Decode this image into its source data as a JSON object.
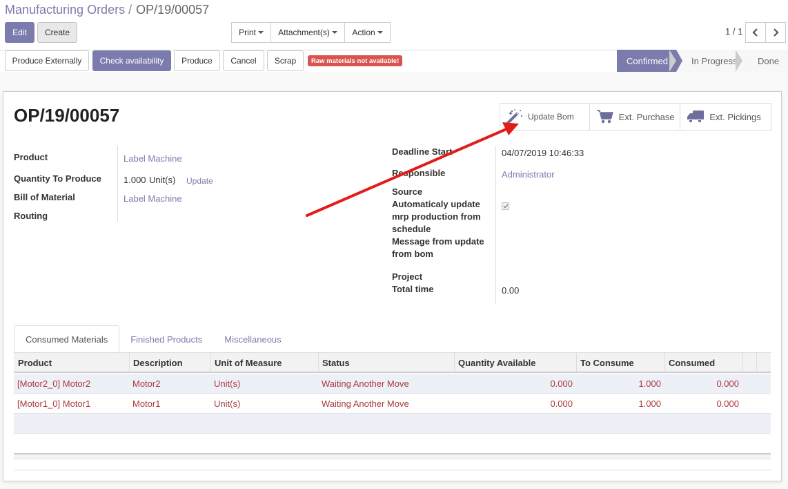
{
  "breadcrumb": {
    "parent": "Manufacturing Orders",
    "separator": "/",
    "current": "OP/19/00057"
  },
  "toolbar": {
    "edit": "Edit",
    "create": "Create",
    "print": "Print",
    "attachments": "Attachment(s)",
    "action": "Action"
  },
  "pager": {
    "value": "1 / 1",
    "prev_icon": "chevron-left-icon",
    "next_icon": "chevron-right-icon"
  },
  "header_buttons": {
    "produce_externally": "Produce Externally",
    "check_availability": "Check availability",
    "produce": "Produce",
    "cancel": "Cancel",
    "scrap": "Scrap",
    "warning_badge": "Raw materials not available!"
  },
  "statusbar": {
    "stages": [
      {
        "label": "Confirmed",
        "active": true
      },
      {
        "label": "In Progress",
        "active": false
      },
      {
        "label": "Done",
        "active": false
      }
    ]
  },
  "smart_buttons": [
    {
      "label": "Update Bom",
      "icon": "magic-wand-icon"
    },
    {
      "label": "Ext. Purchase",
      "icon": "shopping-cart-icon"
    },
    {
      "label": "Ext. Pickings",
      "icon": "truck-icon"
    }
  ],
  "record": {
    "title": "OP/19/00057",
    "left": {
      "product_label": "Product",
      "product_value": "Label Machine",
      "qty_label": "Quantity To Produce",
      "qty_value": "1.000",
      "qty_uom": "Unit(s)",
      "qty_update": "Update",
      "bom_label": "Bill of Material",
      "bom_value": "Label Machine",
      "routing_label": "Routing"
    },
    "right": {
      "deadline_label": "Deadline Start",
      "deadline_value": "04/07/2019 10:46:33",
      "responsible_label": "Responsible",
      "responsible_value": "Administrator",
      "source_label": "Source",
      "auto_update_label_1": "Automaticaly update",
      "auto_update_label_2": "mrp production from",
      "auto_update_label_3": "schedule",
      "message_label_1": "Message from update",
      "message_label_2": "from bom",
      "project_label": "Project",
      "total_time_label": "Total time",
      "total_time_value": "0.00"
    }
  },
  "tabs": [
    "Consumed Materials",
    "Finished Products",
    "Miscellaneous"
  ],
  "table": {
    "headers": [
      "Product",
      "Description",
      "Unit of Measure",
      "Status",
      "Quantity Available",
      "To Consume",
      "Consumed"
    ],
    "rows": [
      [
        "[Motor2_0] Motor2",
        "Motor2",
        "Unit(s)",
        "Waiting Another Move",
        "0.000",
        "1.000",
        "0.000"
      ],
      [
        "[Motor1_0] Motor1",
        "Motor1",
        "Unit(s)",
        "Waiting Another Move",
        "0.000",
        "1.000",
        "0.000"
      ]
    ]
  },
  "colors": {
    "brand": "#7c7bad",
    "danger": "#d9534f",
    "row_text": "#a83a3a",
    "annotation_arrow": "#e41b1b"
  }
}
